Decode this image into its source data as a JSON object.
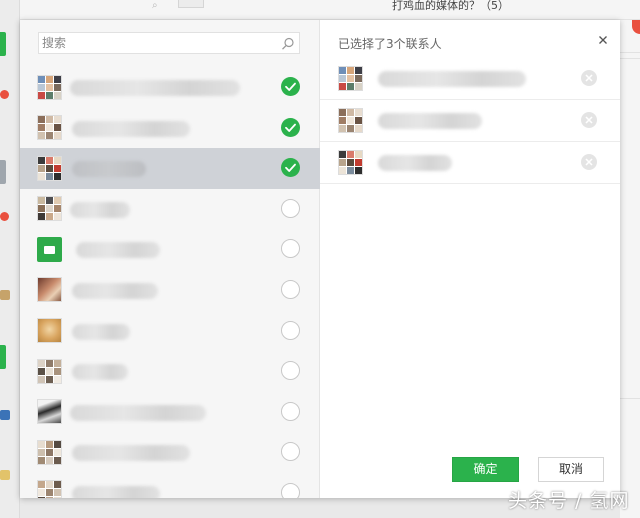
{
  "background": {
    "window_title": "打鸡血的媒体的？（5）"
  },
  "dialog": {
    "search": {
      "placeholder": "搜索",
      "value": ""
    },
    "contacts": [
      {
        "avatar": "group-avatar",
        "selected": true
      },
      {
        "avatar": "photo-avatar",
        "selected": true
      },
      {
        "avatar": "group-avatar",
        "selected": true
      },
      {
        "avatar": "group-avatar",
        "selected": false
      },
      {
        "avatar": "folder-icon",
        "selected": false
      },
      {
        "avatar": "photo-avatar",
        "selected": false
      },
      {
        "avatar": "photo-avatar",
        "selected": false
      },
      {
        "avatar": "group-avatar",
        "selected": false
      },
      {
        "avatar": "photo-avatar",
        "selected": false
      },
      {
        "avatar": "group-avatar",
        "selected": false
      },
      {
        "avatar": "group-avatar",
        "selected": false
      }
    ],
    "selected_header": "已选择了3个联系人",
    "selected": [
      {
        "avatar": "group-avatar"
      },
      {
        "avatar": "photo-avatar"
      },
      {
        "avatar": "group-avatar"
      }
    ],
    "confirm_label": "确定",
    "cancel_label": "取消"
  },
  "watermark": "头条号 / 氢网",
  "colors": {
    "accent": "#2bb24c",
    "selected_row": "#cfd2d7",
    "list_bg": "#f6f6f6"
  }
}
